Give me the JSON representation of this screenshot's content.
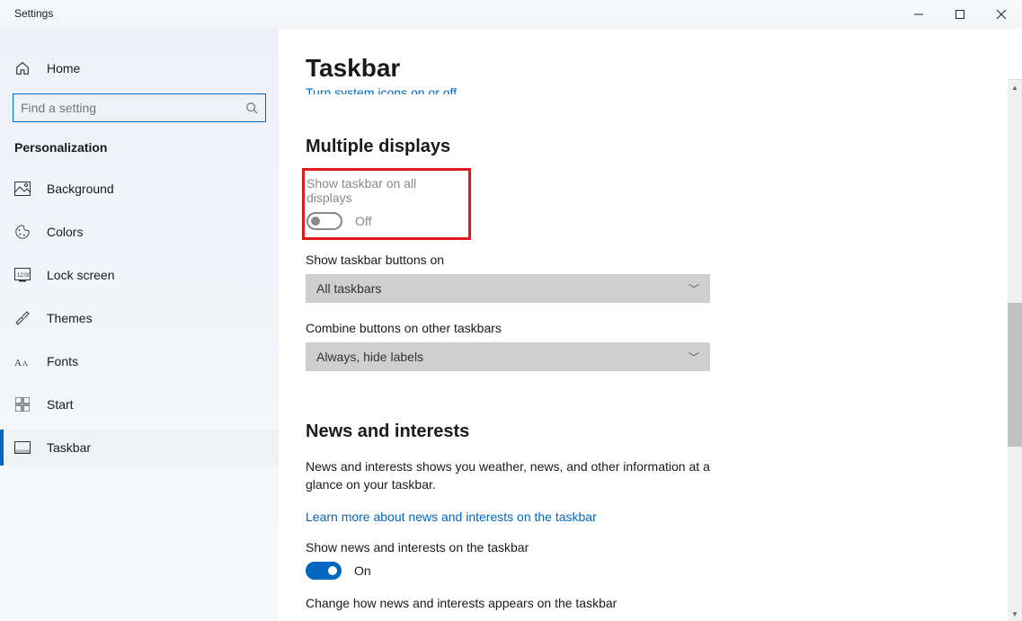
{
  "window": {
    "title": "Settings"
  },
  "sidebar": {
    "home": "Home",
    "search_placeholder": "Find a setting",
    "section": "Personalization",
    "items": [
      {
        "label": "Background"
      },
      {
        "label": "Colors"
      },
      {
        "label": "Lock screen"
      },
      {
        "label": "Themes"
      },
      {
        "label": "Fonts"
      },
      {
        "label": "Start"
      },
      {
        "label": "Taskbar"
      }
    ]
  },
  "main": {
    "title": "Taskbar",
    "cutoff_link": "Turn system icons on or off",
    "multiple_displays": {
      "heading": "Multiple displays",
      "show_all": {
        "label": "Show taskbar on all displays",
        "state": "Off"
      },
      "buttons_on": {
        "label": "Show taskbar buttons on",
        "value": "All taskbars"
      },
      "combine": {
        "label": "Combine buttons on other taskbars",
        "value": "Always, hide labels"
      }
    },
    "news": {
      "heading": "News and interests",
      "desc": "News and interests shows you weather, news, and other information at a glance on your taskbar.",
      "learn_more": "Learn more about news and interests on the taskbar",
      "show_label": "Show news and interests on the taskbar",
      "show_state": "On",
      "change_label": "Change how news and interests appears on the taskbar"
    }
  }
}
